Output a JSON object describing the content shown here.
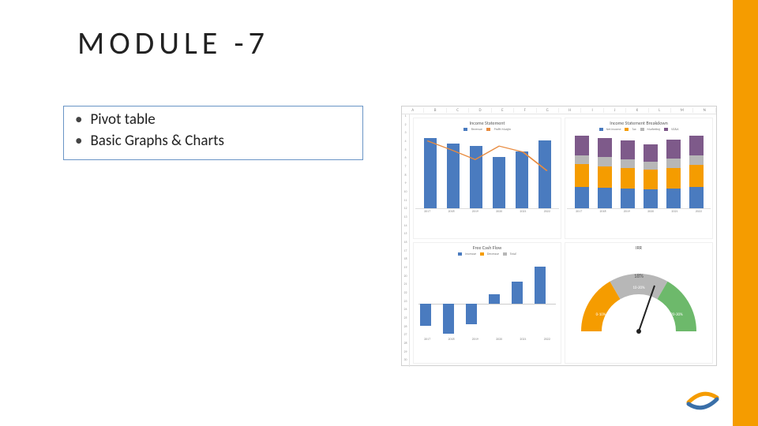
{
  "title": "MODULE -7",
  "bullets": [
    "Pivot table",
    "Basic Graphs & Charts"
  ],
  "screenshot": {
    "columns": [
      "A",
      "B",
      "C",
      "D",
      "E",
      "F",
      "G",
      "H",
      "I",
      "J",
      "K",
      "L",
      "M",
      "N"
    ],
    "rows_shown": 30
  },
  "colors": {
    "accent": "#f59c00",
    "blue": "#4a7bbf",
    "orange": "#f59c00",
    "gray": "#b7b7b7",
    "plum": "#7e5a8a",
    "green": "#6db96b"
  },
  "chart_data": [
    {
      "type": "bar",
      "title": "Income Statement",
      "categories": [
        "2017",
        "2018",
        "2019",
        "2020",
        "2021",
        "2022"
      ],
      "series": [
        {
          "name": "Revenue",
          "color": "#4a7bbf",
          "values": [
            130000,
            120000,
            115000,
            95000,
            105000,
            125000
          ]
        }
      ],
      "overlay_line": {
        "name": "Profit Margin",
        "color": "#e88b3f",
        "values": [
          9.0,
          7.8,
          6.5,
          8.3,
          7.5,
          5.0
        ]
      },
      "ylabel": "",
      "xlabel": "",
      "ylim": [
        0,
        140000
      ],
      "yticks": [
        20000,
        40000,
        60000,
        80000,
        100000,
        120000,
        140000
      ],
      "y2lim": [
        0,
        10
      ],
      "y2ticks": [
        "0.0%",
        "1.0%",
        "2.0%",
        "3.0%",
        "4.0%",
        "5.0%",
        "6.0%",
        "7.0%",
        "8.0%",
        "9.0%",
        "10.0%"
      ]
    },
    {
      "type": "bar",
      "title": "Income Statement Breakdown",
      "stacked": true,
      "categories": [
        "2017",
        "2018",
        "2019",
        "2020",
        "2021",
        "2022"
      ],
      "series": [
        {
          "name": "Net Income",
          "color": "#4a7bbf",
          "values": [
            4000,
            3800,
            3600,
            3500,
            3700,
            3900
          ]
        },
        {
          "name": "Tax",
          "color": "#f59c00",
          "values": [
            4100,
            4000,
            3900,
            3600,
            3800,
            4100
          ]
        },
        {
          "name": "Marketing",
          "color": "#b7b7b7",
          "values": [
            1700,
            1700,
            1600,
            1500,
            1700,
            1800
          ]
        },
        {
          "name": "SG&A",
          "color": "#7e5a8a",
          "values": [
            3600,
            3500,
            3400,
            3200,
            3500,
            3600
          ]
        }
      ],
      "ylabel": "",
      "xlabel": "",
      "ylim": [
        0,
        14000
      ],
      "yticks": [
        2000,
        4000,
        6000,
        8000,
        10000,
        12000,
        14000
      ]
    },
    {
      "type": "bar",
      "title": "Free Cash Flow",
      "categories": [
        "2017",
        "2018",
        "2019",
        "2020",
        "2021",
        "2022"
      ],
      "series": [
        {
          "name": "Increase",
          "color": "#4a7bbf",
          "values": [
            -4500,
            -6000,
            -4200,
            2000,
            4500,
            7500
          ]
        },
        {
          "name": "Decrease",
          "color": "#f59c00",
          "values": [
            0,
            0,
            0,
            0,
            0,
            0
          ]
        },
        {
          "name": "Total",
          "color": "#b7b7b7",
          "values": [
            0,
            0,
            0,
            0,
            0,
            0
          ]
        }
      ],
      "ylabel": "",
      "xlabel": "",
      "ylim": [
        -8000,
        8000
      ],
      "yticks": [
        -8000,
        -6000,
        -4000,
        -2000,
        0,
        2000,
        4000,
        6000,
        8000
      ]
    },
    {
      "type": "pie",
      "title": "IRR",
      "gauge": true,
      "value_label": "18%",
      "bands": [
        {
          "label": "0-10%",
          "color": "#f59c00"
        },
        {
          "label": "10-20%",
          "color": "#b7b7b7"
        },
        {
          "label": "20-30%",
          "color": "#6db96b"
        }
      ],
      "needle_value_percent_of_range": 60
    }
  ]
}
